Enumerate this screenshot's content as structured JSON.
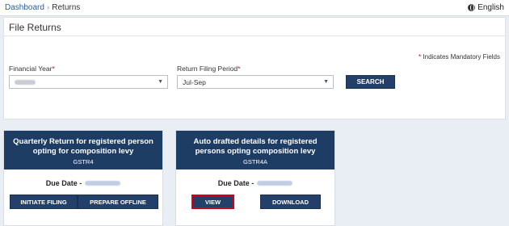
{
  "breadcrumb": {
    "home": "Dashboard",
    "separator": "›",
    "current": "Returns"
  },
  "language": {
    "label": "English",
    "icon": "globe-icon"
  },
  "panel": {
    "title": "File Returns",
    "mandatory_star": "*",
    "mandatory_note": "Indicates Mandatory Fields",
    "financial_year": {
      "label": "Financial Year",
      "required_mark": "*",
      "value_redacted": true
    },
    "return_period": {
      "label": "Return Filing Period",
      "required_mark": "*",
      "value": "Jul-Sep"
    },
    "search_label": "SEARCH"
  },
  "cards": [
    {
      "title": "Quarterly Return for registered person opting for composition levy",
      "code": "GSTR4",
      "due_label": "Due Date -",
      "due_value_redacted": true,
      "buttons": [
        "INITIATE FILING",
        "PREPARE OFFLINE"
      ]
    },
    {
      "title": "Auto drafted details for registered persons opting composition levy",
      "code": "GSTR4A",
      "due_label": "Due Date -",
      "due_value_redacted": true,
      "buttons": [
        "VIEW",
        "DOWNLOAD"
      ],
      "highlighted_button": "VIEW"
    }
  ],
  "colors": {
    "header_navy": "#1e3d64",
    "button_navy": "#22406a",
    "link_blue": "#1f5fa6",
    "required_red": "#d0021b",
    "page_bg": "#e9eef4"
  }
}
